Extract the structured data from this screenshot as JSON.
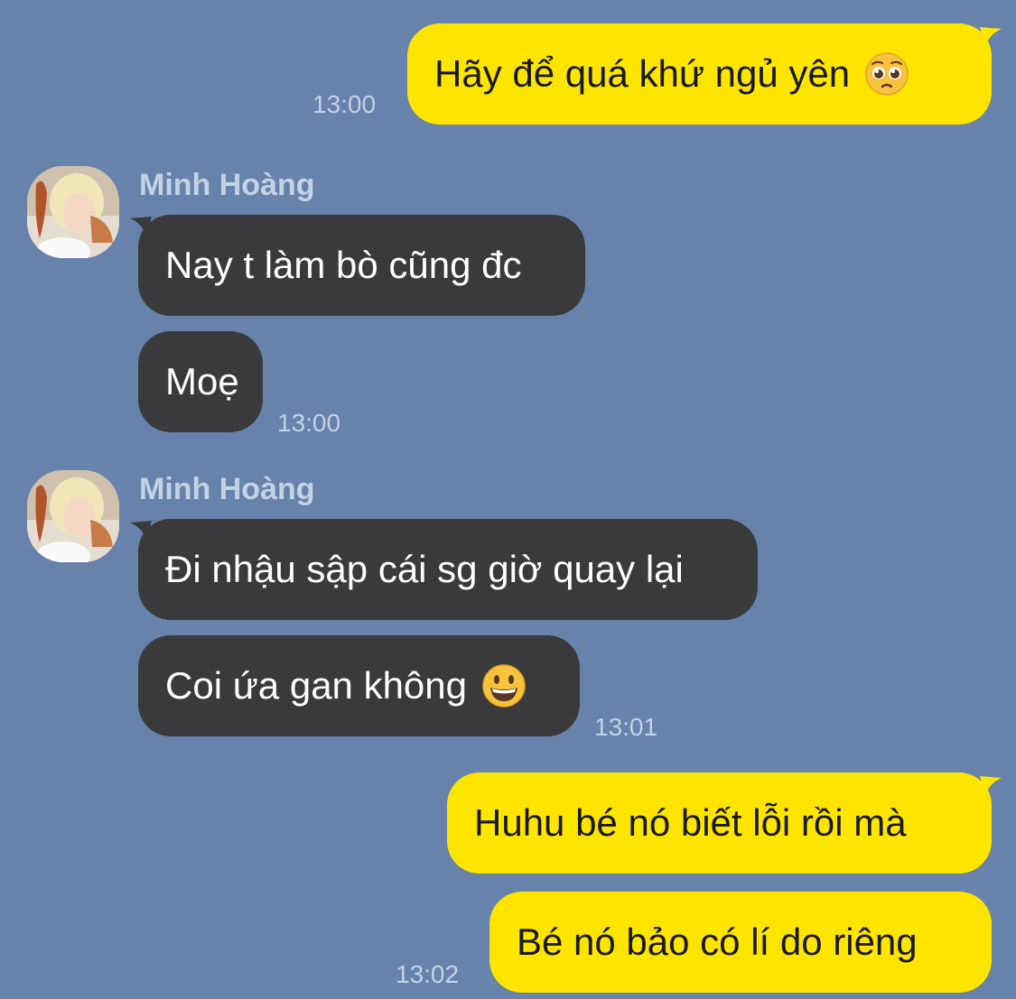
{
  "messages": [
    {
      "id": "m1",
      "direction": "outgoing",
      "text": "Hãy để quá khứ ngủ yên",
      "emoji": "pleading-face",
      "time": "13:00"
    },
    {
      "id": "g1",
      "direction": "incoming",
      "sender": "Minh Hoàng",
      "messages": [
        {
          "text": "Nay t làm bò cũng đc"
        },
        {
          "text": "Moẹ",
          "time": "13:00"
        }
      ]
    },
    {
      "id": "g2",
      "direction": "incoming",
      "sender": "Minh Hoàng",
      "messages": [
        {
          "text": "Đi nhậu sập cái sg giờ quay lại"
        },
        {
          "text": "Coi ứa gan không",
          "emoji": "grinning-face",
          "time": "13:01"
        }
      ]
    },
    {
      "id": "m2",
      "direction": "outgoing",
      "text": "Huhu bé nó biết lỗi rồi mà"
    },
    {
      "id": "m3",
      "direction": "outgoing",
      "text": "Bé nó bảo có lí do riêng",
      "time": "13:02"
    }
  ],
  "colors": {
    "background": "#6783ab",
    "outgoing_bubble": "#fee500",
    "incoming_bubble": "#3a3a3c",
    "meta_text": "#c4d2e6"
  }
}
